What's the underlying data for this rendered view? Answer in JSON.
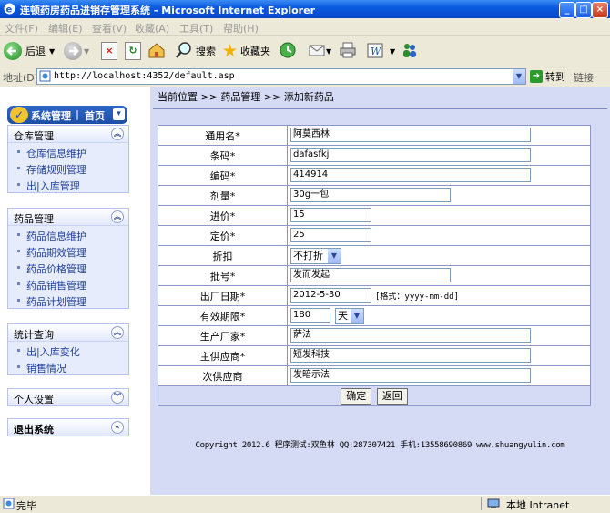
{
  "window": {
    "title": "连顿药房药品进销存管理系统 - Microsoft Internet Explorer"
  },
  "menu": [
    "文件(F)",
    "编辑(E)",
    "查看(V)",
    "收藏(A)",
    "工具(T)",
    "帮助(H)"
  ],
  "toolbar": {
    "back": "后退",
    "search": "搜索",
    "favorites": "收藏夹"
  },
  "address": {
    "label": "地址(D)",
    "url": "http://localhost:4352/default.asp",
    "go": "转到",
    "links": "链接"
  },
  "sidebar": {
    "logo_text": "系统管理",
    "home": "首页",
    "sections": [
      {
        "title": "仓库管理",
        "items": [
          "仓库信息维护",
          "存储规则管理",
          "出|入库管理"
        ]
      },
      {
        "title": "药品管理",
        "items": [
          "药品信息维护",
          "药品期效管理",
          "药品价格管理",
          "药品销售管理",
          "药品计划管理"
        ]
      },
      {
        "title": "统计查询",
        "items": [
          "出|入库变化",
          "销售情况"
        ]
      },
      {
        "title": "个人设置",
        "items": []
      },
      {
        "title": "退出系统",
        "items": []
      }
    ]
  },
  "breadcrumb": "当前位置 >> 药品管理 >> 添加新药品",
  "form": {
    "rows": [
      {
        "label": "通用名*",
        "value": "阿莫西林"
      },
      {
        "label": "条码*",
        "value": "dafasfkj"
      },
      {
        "label": "编码*",
        "value": "414914"
      },
      {
        "label": "剂量*",
        "value": "30g一包"
      },
      {
        "label": "进价*",
        "value": "15"
      },
      {
        "label": "定价*",
        "value": "25"
      },
      {
        "label": "折扣",
        "value": "不打折"
      },
      {
        "label": "批号*",
        "value": "发而发起"
      },
      {
        "label": "出厂日期*",
        "value": "2012-5-30",
        "hint": "[格式：yyyy-mm-dd]"
      },
      {
        "label": "有效期限*",
        "value": "180",
        "unit": "天"
      },
      {
        "label": "生产厂家*",
        "value": "萨法"
      },
      {
        "label": "主供应商*",
        "value": "短发科技"
      },
      {
        "label": "次供应商",
        "value": "发暗示法"
      }
    ],
    "confirm": "确定",
    "back": "返回"
  },
  "footer": "Copyright 2012.6 程序测试:双鱼林 QQ:287307421 手机:13558690869 www.shuangyulin.com",
  "status": {
    "text": "完毕",
    "zone": "本地 Intranet"
  }
}
